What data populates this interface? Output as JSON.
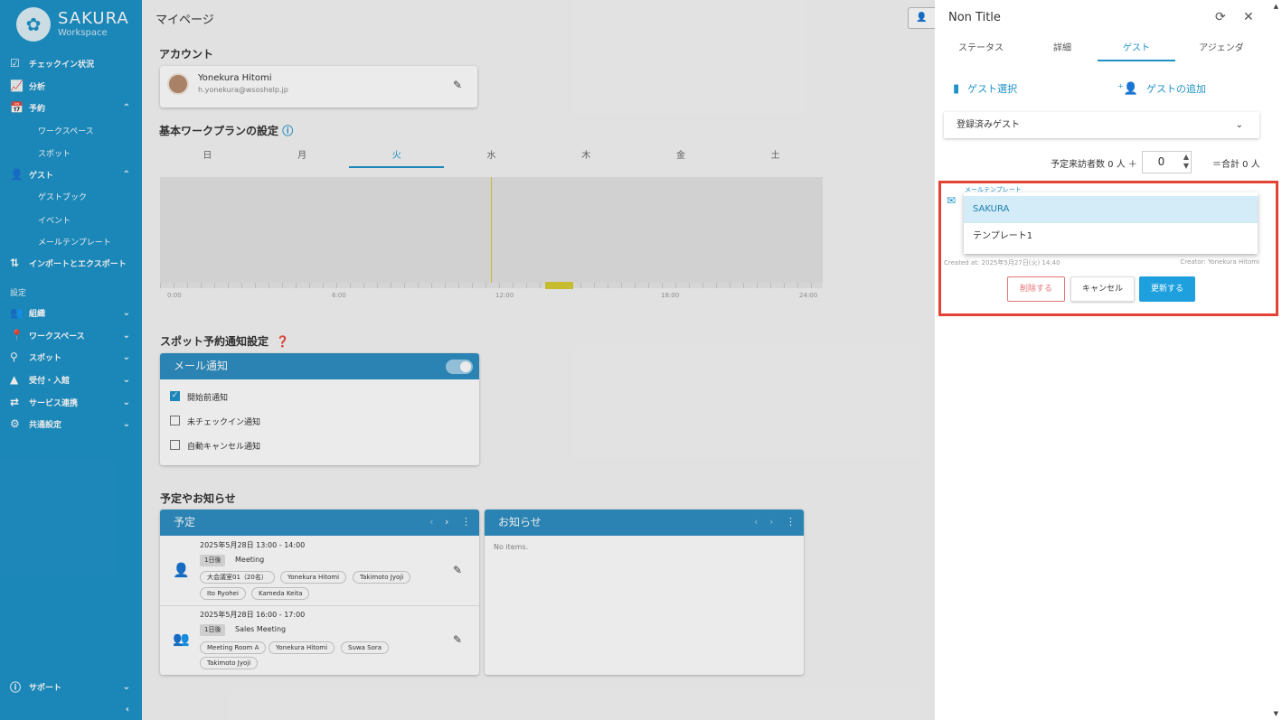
{
  "sidebar": {
    "logo_title": "SAKURA",
    "logo_sub": "Workspace",
    "items": [
      {
        "label": "チェックイン状況",
        "icon": "checkbox-icon"
      },
      {
        "label": "分析",
        "icon": "chart-icon"
      },
      {
        "label": "予約",
        "icon": "calendar-icon"
      },
      {
        "label": "ワークスペース"
      },
      {
        "label": "スポット"
      },
      {
        "label": "ゲスト",
        "icon": "person-icon"
      },
      {
        "label": "ゲストブック"
      },
      {
        "label": "イベント"
      },
      {
        "label": "メールテンプレート"
      },
      {
        "label": "インポートとエクスポート",
        "icon": "import-export-icon"
      }
    ],
    "settings_label": "設定",
    "settings_items": [
      {
        "label": "組織"
      },
      {
        "label": "ワークスペース"
      },
      {
        "label": "スポット"
      },
      {
        "label": "受付・入館"
      },
      {
        "label": "サービス連携"
      },
      {
        "label": "共通設定"
      }
    ],
    "support_label": "サポート",
    "collapse_icon": "chevron-left-icon"
  },
  "main": {
    "page_title": "マイページ",
    "account_heading": "アカウント",
    "user_name": "Yonekura  Hitomi",
    "user_email": "h.yonekura@wsoshelp.jp",
    "workplan_heading": "基本ワークプランの設定",
    "days": [
      "日",
      "月",
      "火",
      "水",
      "木",
      "金",
      "土"
    ],
    "active_day": "火",
    "time_labels": [
      "0:00",
      "6:00",
      "12:00",
      "18:00",
      "24:00"
    ],
    "spot_heading": "スポット予約通知設定",
    "mail_card_title": "メール通知",
    "checkboxes": [
      {
        "label": "開始前通知",
        "checked": true
      },
      {
        "label": "未チェックイン通知",
        "checked": false
      },
      {
        "label": "自動キャンセル通知",
        "checked": false
      }
    ],
    "schedule_heading": "予定やお知らせ",
    "schedule_title": "予定",
    "news_title": "お知らせ",
    "news_empty": "No items.",
    "events": [
      {
        "date": "2025年5月28日  13:00 - 14:00",
        "badge": "1日後",
        "title": "Meeting",
        "chips": [
          "大会議室01（20名）",
          "Yonekura Hitomi",
          "Takimoto Jyoji",
          "Ito Ryohei",
          "Kameda Keita"
        ]
      },
      {
        "date": "2025年5月28日  16:00 - 17:00",
        "badge": "1日後",
        "title": "Sales Meeting",
        "chips": [
          "Meeting Room A",
          "Yonekura Hitomi",
          "Suwa Sora",
          "Takimoto Jyoji"
        ]
      }
    ]
  },
  "drawer": {
    "title": "Non Title",
    "tabs": [
      "ステータス",
      "詳細",
      "ゲスト",
      "アジェンダ"
    ],
    "active_tab": "ゲスト",
    "select_guest": "ゲスト選択",
    "add_guest": "ゲストの追加",
    "registered_guests": "登録済みゲスト",
    "visitors_prefix": "予定来訪者数 0 人 ＋",
    "visitor_count": "0",
    "visitors_total": "＝合計 0 人",
    "template_label": "メールテンプレート",
    "template_options": [
      "SAKURA",
      "テンプレート1"
    ],
    "selected_template": "SAKURA",
    "created_at": "Created at: 2025年5月27日(火) 14:40",
    "creator": "Creator: Yonekura Hitomi",
    "delete_label": "削除する",
    "cancel_label": "キャンセル",
    "update_label": "更新する"
  },
  "colors": {
    "brand": "#1e93c8",
    "header_blue": "#2f8fc3",
    "highlight_red": "#e34234",
    "accent_yellow": "#d8cc33"
  }
}
